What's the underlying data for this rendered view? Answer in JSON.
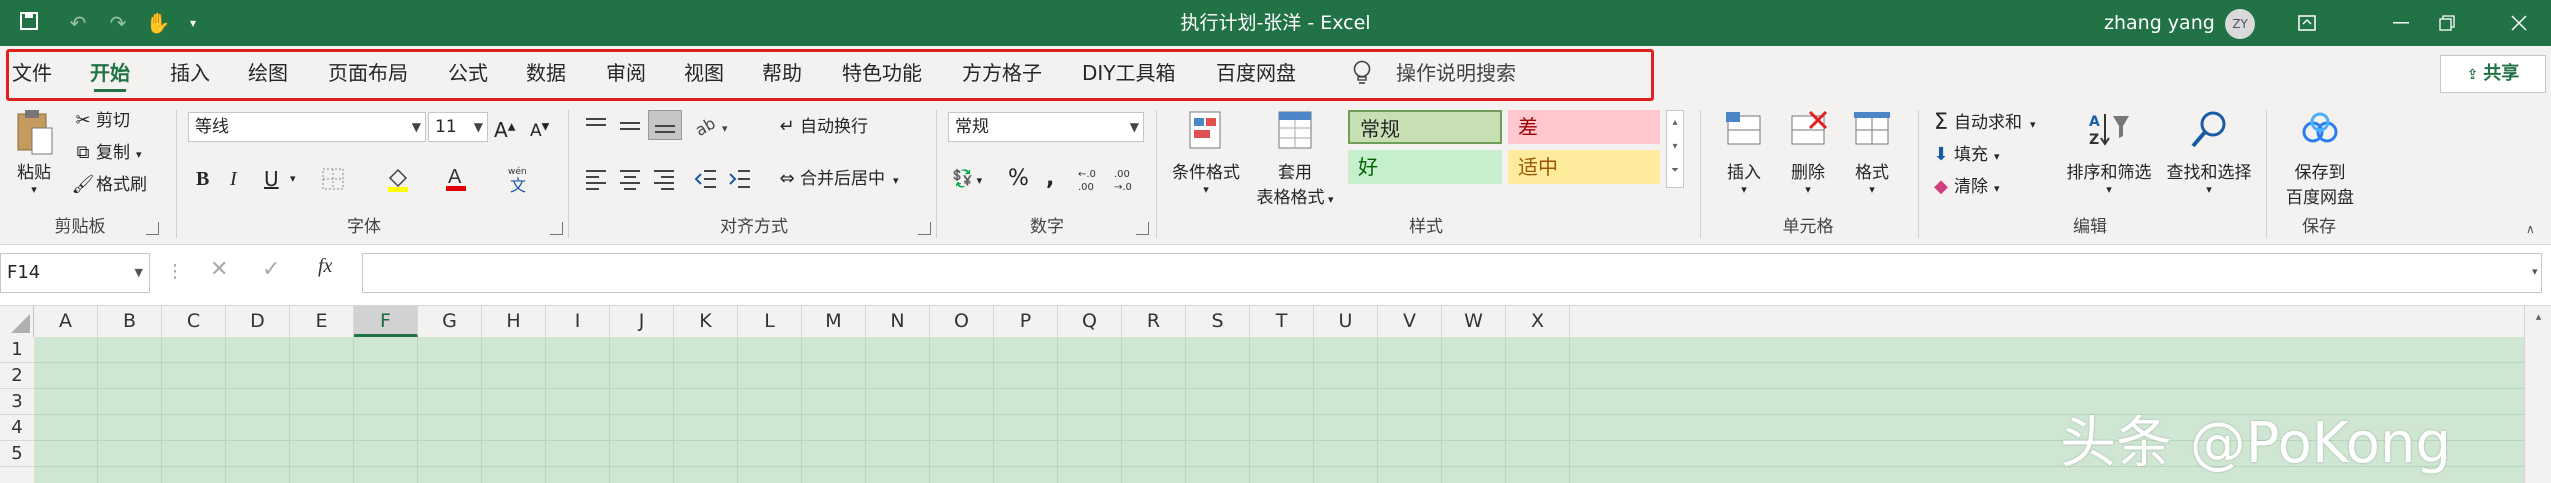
{
  "titlebar": {
    "title": "执行计划-张洋  -  Excel",
    "user_name": "zhang yang",
    "avatar_initials": "ZY",
    "bg_color": "#217346"
  },
  "tabs": [
    "文件",
    "开始",
    "插入",
    "绘图",
    "页面布局",
    "公式",
    "数据",
    "审阅",
    "视图",
    "帮助",
    "特色功能",
    "方方格子",
    "DIY工具箱",
    "百度网盘"
  ],
  "active_tab": "开始",
  "tell_me": "操作说明搜索",
  "share_label": "共享",
  "clipboard": {
    "paste": "粘贴",
    "cut": "剪切",
    "copy": "复制",
    "format_painter": "格式刷",
    "group": "剪贴板"
  },
  "font": {
    "name": "等线",
    "size": "11",
    "group": "字体",
    "bold": "B",
    "italic": "I",
    "underline": "U"
  },
  "alignment": {
    "wrap": "自动换行",
    "merge": "合并后居中",
    "group": "对齐方式"
  },
  "number": {
    "format": "常规",
    "group": "数字"
  },
  "styles": {
    "conditional": "条件格式",
    "table_line1": "套用",
    "table_line2": "表格格式",
    "normal": "常规",
    "bad": "差",
    "good": "好",
    "neutral": "适中",
    "group": "样式"
  },
  "cells": {
    "insert": "插入",
    "delete": "删除",
    "format": "格式",
    "group": "单元格"
  },
  "editing": {
    "autosum": "自动求和",
    "fill": "填充",
    "clear": "清除",
    "sort": "排序和筛选",
    "find": "查找和选择",
    "group": "编辑"
  },
  "save": {
    "line1": "保存到",
    "line2": "百度网盘",
    "group": "保存"
  },
  "formula_bar": {
    "name_box": "F14",
    "fx": "fx"
  },
  "columns": [
    "A",
    "B",
    "C",
    "D",
    "E",
    "F",
    "G",
    "H",
    "I",
    "J",
    "K",
    "L",
    "M",
    "N",
    "O",
    "P",
    "Q",
    "R",
    "S",
    "T",
    "U",
    "V",
    "W",
    "X"
  ],
  "selected_column": "F",
  "rows": [
    "1",
    "2",
    "3",
    "4",
    "5"
  ],
  "watermark": "头条 @PoKong"
}
